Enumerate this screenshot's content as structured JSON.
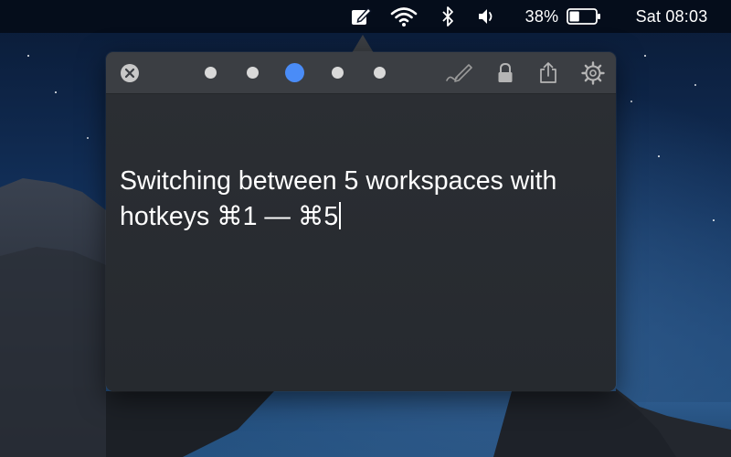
{
  "menubar": {
    "battery_percent": "38%",
    "battery_level": 0.38,
    "clock": "Sat 08:03",
    "icons": [
      "notes-menu-icon",
      "wifi-icon",
      "bluetooth-icon",
      "volume-icon",
      "battery-icon"
    ]
  },
  "popover": {
    "toolbar": {
      "close_icon": "close-circle-icon",
      "workspaces": [
        {
          "index": 1,
          "active": false
        },
        {
          "index": 2,
          "active": false
        },
        {
          "index": 3,
          "active": true
        },
        {
          "index": 4,
          "active": false
        },
        {
          "index": 5,
          "active": false
        }
      ],
      "right_icons": [
        "pen-icon",
        "lock-icon",
        "share-icon",
        "gear-icon"
      ]
    },
    "note": {
      "text": "Switching between 5 workspaces with hotkeys ⌘1 — ⌘5"
    }
  },
  "colors": {
    "accent": "#4a8cf7",
    "dot_inactive": "#d9d9d9",
    "toolbar_bg": "#3b3e43",
    "editor_bg": "#2a2d32"
  }
}
